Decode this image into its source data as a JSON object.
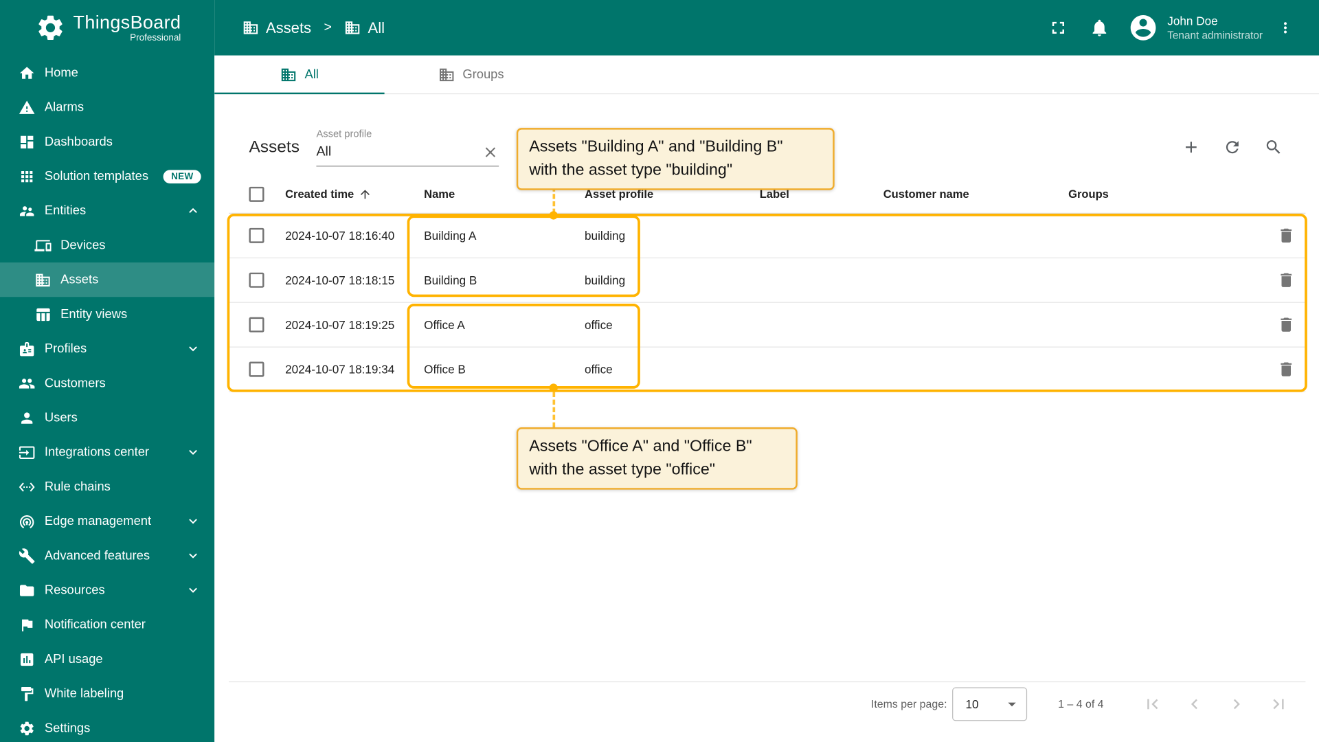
{
  "colors": {
    "primary": "#00756B",
    "accent_amber": "#FFB300",
    "annotation_bg": "#FBF2DA"
  },
  "brand": {
    "name": "ThingsBoard",
    "edition": "Professional"
  },
  "header": {
    "breadcrumb": [
      {
        "label": "Assets"
      },
      {
        "label": "All"
      }
    ],
    "separator": ">",
    "user": {
      "name": "John Doe",
      "role": "Tenant administrator"
    }
  },
  "sidebar": {
    "items": [
      {
        "label": "Home"
      },
      {
        "label": "Alarms"
      },
      {
        "label": "Dashboards"
      },
      {
        "label": "Solution templates",
        "badge": "NEW"
      },
      {
        "label": "Entities",
        "expanded": true
      },
      {
        "label": "Devices",
        "sub": true
      },
      {
        "label": "Assets",
        "sub": true,
        "active": true
      },
      {
        "label": "Entity views",
        "sub": true
      },
      {
        "label": "Profiles",
        "collapsible": true
      },
      {
        "label": "Customers"
      },
      {
        "label": "Users"
      },
      {
        "label": "Integrations center",
        "collapsible": true
      },
      {
        "label": "Rule chains"
      },
      {
        "label": "Edge management",
        "collapsible": true
      },
      {
        "label": "Advanced features",
        "collapsible": true
      },
      {
        "label": "Resources",
        "collapsible": true
      },
      {
        "label": "Notification center"
      },
      {
        "label": "API usage"
      },
      {
        "label": "White labeling"
      },
      {
        "label": "Settings"
      }
    ]
  },
  "tabs": [
    {
      "label": "All",
      "active": true
    },
    {
      "label": "Groups",
      "active": false
    }
  ],
  "toolbar": {
    "title": "Assets",
    "filter_label": "Asset profile",
    "filter_value": "All"
  },
  "table": {
    "columns": {
      "created": "Created time",
      "name": "Name",
      "profile": "Asset profile",
      "label": "Label",
      "customer": "Customer name",
      "groups": "Groups"
    },
    "rows": [
      {
        "created": "2024-10-07 18:16:40",
        "name": "Building A",
        "profile": "building",
        "label": "",
        "customer": "",
        "groups": ""
      },
      {
        "created": "2024-10-07 18:18:15",
        "name": "Building B",
        "profile": "building",
        "label": "",
        "customer": "",
        "groups": ""
      },
      {
        "created": "2024-10-07 18:19:25",
        "name": "Office A",
        "profile": "office",
        "label": "",
        "customer": "",
        "groups": ""
      },
      {
        "created": "2024-10-07 18:19:34",
        "name": "Office B",
        "profile": "office",
        "label": "",
        "customer": "",
        "groups": ""
      }
    ]
  },
  "annotations": {
    "building": "Assets \"Building A\" and \"Building B\"\nwith the asset type \"building\"",
    "office": "Assets \"Office A\" and \"Office B\"\nwith the asset type \"office\""
  },
  "pagination": {
    "items_per_page_label": "Items per page:",
    "page_size": "10",
    "range": "1 – 4 of 4"
  },
  "icons": {
    "breadcrumb": "building-icon",
    "toolbar_actions": [
      "add-icon",
      "refresh-icon",
      "search-icon"
    ],
    "row_action": "delete-icon",
    "filter_action": "clear-icon",
    "sort": "arrow-upward-icon",
    "pagination_nav": [
      "first-page-icon",
      "prev-page-icon",
      "next-page-icon",
      "last-page-icon"
    ]
  }
}
